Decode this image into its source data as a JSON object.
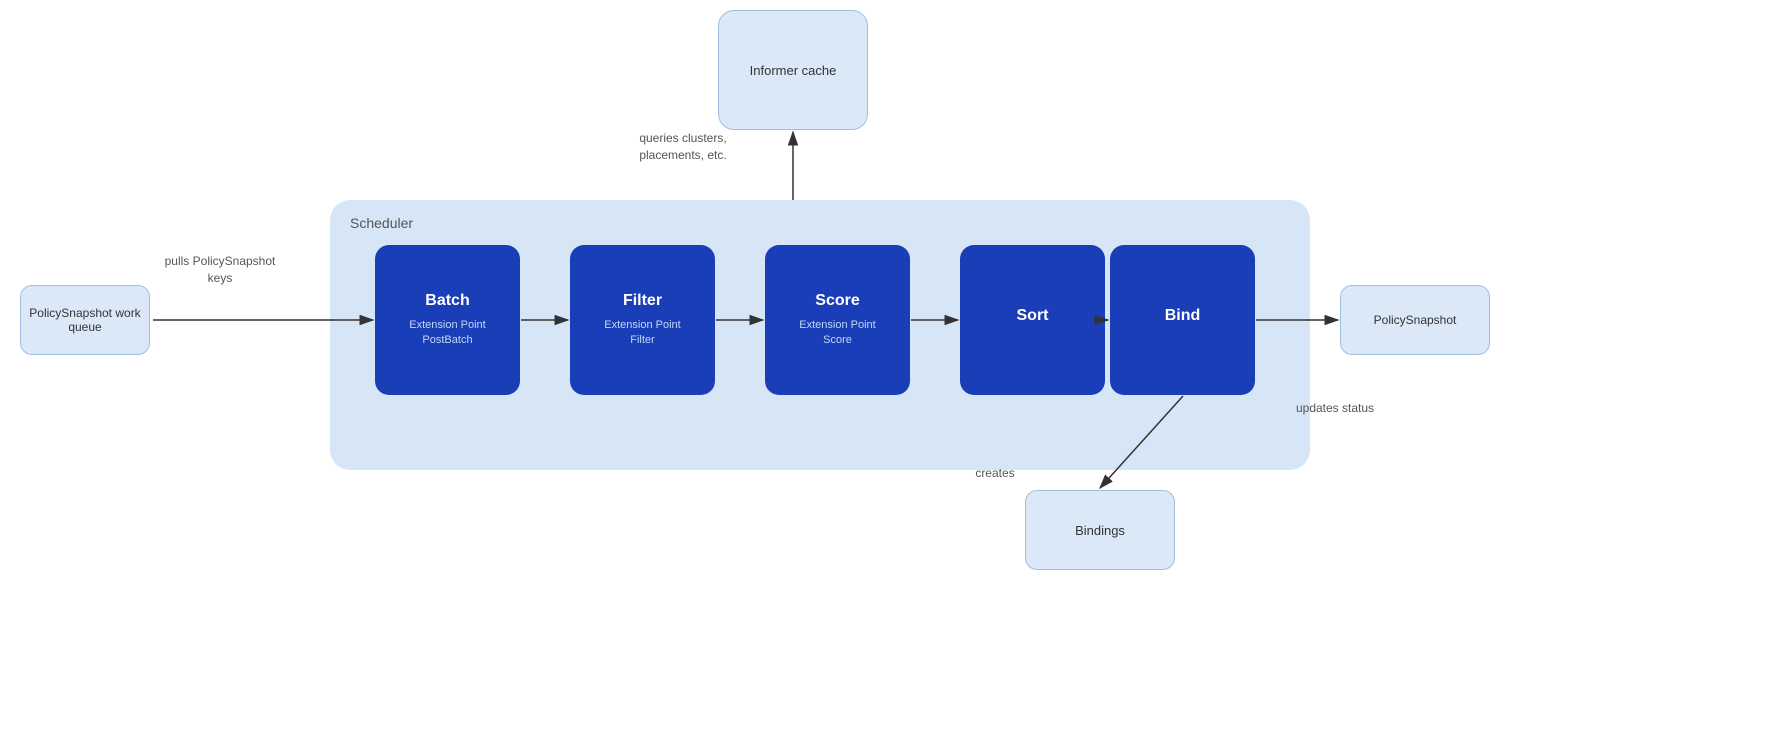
{
  "informer_cache": {
    "label": "Informer cache"
  },
  "policy_snapshot_queue": {
    "label": "PolicySnapshot work queue"
  },
  "policy_snapshot_out": {
    "label": "PolicySnapshot"
  },
  "bindings": {
    "label": "Bindings"
  },
  "scheduler": {
    "label": "Scheduler"
  },
  "steps": [
    {
      "id": "batch",
      "title": "Batch",
      "sub": "Extension Point\nPostBatch"
    },
    {
      "id": "filter",
      "title": "Filter",
      "sub": "Extension Point\nFilter"
    },
    {
      "id": "score",
      "title": "Score",
      "sub": "Extension Point\nScore"
    },
    {
      "id": "sort",
      "title": "Sort",
      "sub": ""
    },
    {
      "id": "bind",
      "title": "Bind",
      "sub": ""
    }
  ],
  "arrow_labels": {
    "pulls": "pulls\nPolicySnapshot\nkeys",
    "queries": "queries\nclusters,\nplacements,\netc.",
    "updates": "updates\nstatus",
    "creates": "creates"
  },
  "colors": {
    "step_bg": "#1a3eb8",
    "light_box_bg": "#dbe8f8",
    "scheduler_bg": "#d6e6f7",
    "arrow_color": "#333333"
  }
}
